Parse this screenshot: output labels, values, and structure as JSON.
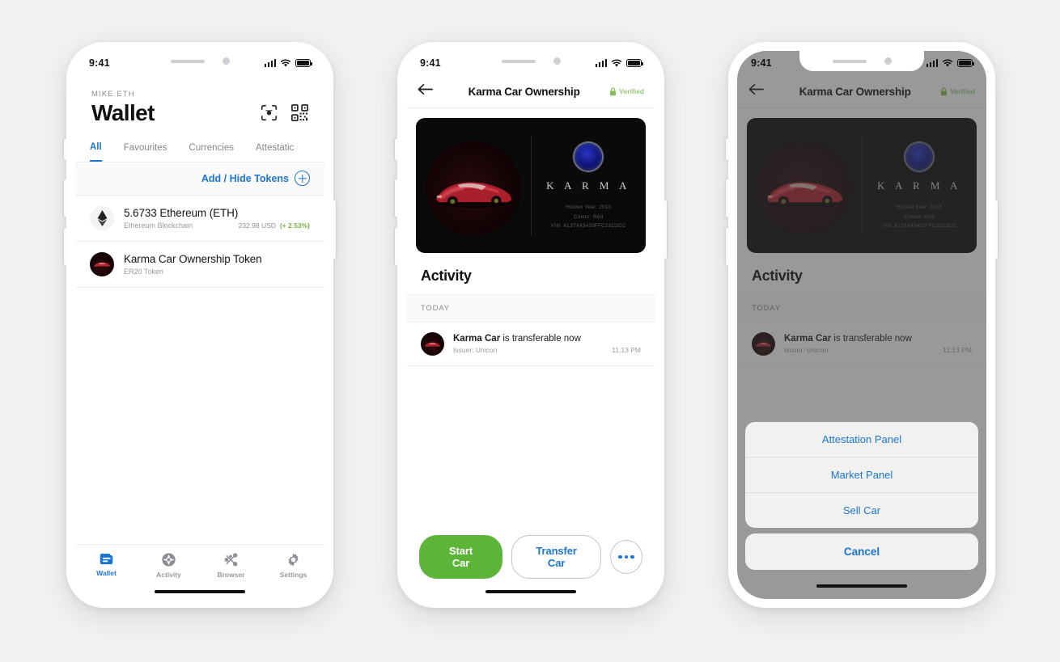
{
  "background_color": "#f2f2f2",
  "accent_blue": "#1b76d2",
  "accent_green": "#5cb439",
  "phones": {
    "wallet": {
      "status": {
        "time": "9:41"
      },
      "header": {
        "account": "MIKE.ETH",
        "title": "Wallet"
      },
      "icons": {
        "scan": "camera-scan-icon",
        "qr": "qr-code-icon"
      },
      "tabs": [
        {
          "label": "All",
          "active": true
        },
        {
          "label": "Favourites",
          "active": false
        },
        {
          "label": "Currencies",
          "active": false
        },
        {
          "label": "Attestatic",
          "active": false
        }
      ],
      "add_hide": {
        "label": "Add / Hide Tokens",
        "icon": "plus-circle-icon"
      },
      "tokens": [
        {
          "title": "5.6733 Ethereum (ETH)",
          "subtitle": "Ethereum Blockchain",
          "value": "232.98 USD",
          "change": "(+ 2.53%)",
          "icon": "ethereum-icon"
        },
        {
          "title": "Karma Car Ownership Token",
          "subtitle": "ER20 Token",
          "value": "",
          "change": "",
          "icon": "karma-car-icon"
        }
      ],
      "tabbar": [
        {
          "label": "Wallet",
          "icon": "wallet-icon",
          "active": true
        },
        {
          "label": "Activity",
          "icon": "activity-icon",
          "active": false
        },
        {
          "label": "Browser",
          "icon": "browser-network-icon",
          "active": false
        },
        {
          "label": "Settings",
          "icon": "gear-icon",
          "active": false
        }
      ]
    },
    "detail": {
      "status": {
        "time": "9:41"
      },
      "navbar": {
        "back": "back-arrow-icon",
        "title": "Karma Car Ownership",
        "verified_label": "Verified",
        "verified_icon": "lock-icon"
      },
      "card": {
        "brand": "K A R M A",
        "logo": "karma-emblem-icon",
        "car_image": "red-karma-car",
        "meta": [
          "Holden Year: 2013",
          "Colour: Red",
          "VIN: KL3TA43420FFC21C2CC"
        ]
      },
      "activity": {
        "heading": "Activity",
        "group": "TODAY",
        "rows": [
          {
            "title_bold": "Karma Car",
            "title_rest": " is transferable now",
            "subtitle": "Issuer: Unicon",
            "time": "11:13 PM",
            "icon": "karma-car-icon"
          }
        ]
      },
      "actions": {
        "primary": "Start Car",
        "secondary": "Transfer Car",
        "more_icon": "more-dots-icon"
      }
    },
    "sheet": {
      "status": {
        "time": "9:41"
      },
      "navbar": {
        "back": "back-arrow-icon",
        "title": "Karma Car Ownership",
        "verified_label": "Verified",
        "verified_icon": "lock-icon"
      },
      "card": {
        "brand": "K A R M A",
        "logo": "karma-emblem-icon",
        "car_image": "red-karma-car",
        "meta": [
          "Holden Year: 2013",
          "Colour: Red",
          "VIN: KL3TA43420FFC21C2CC"
        ]
      },
      "activity": {
        "heading": "Activity",
        "group": "TODAY",
        "rows": [
          {
            "title_bold": "Karma Car",
            "title_rest": " is transferable now",
            "subtitle": "Issuer: Unicon",
            "time": "11:13 PM",
            "icon": "karma-car-icon"
          }
        ]
      },
      "action_sheet": {
        "options": [
          {
            "label": "Attestation Panel"
          },
          {
            "label": "Market Panel"
          },
          {
            "label": "Sell Car"
          }
        ],
        "cancel": "Cancel"
      }
    }
  }
}
